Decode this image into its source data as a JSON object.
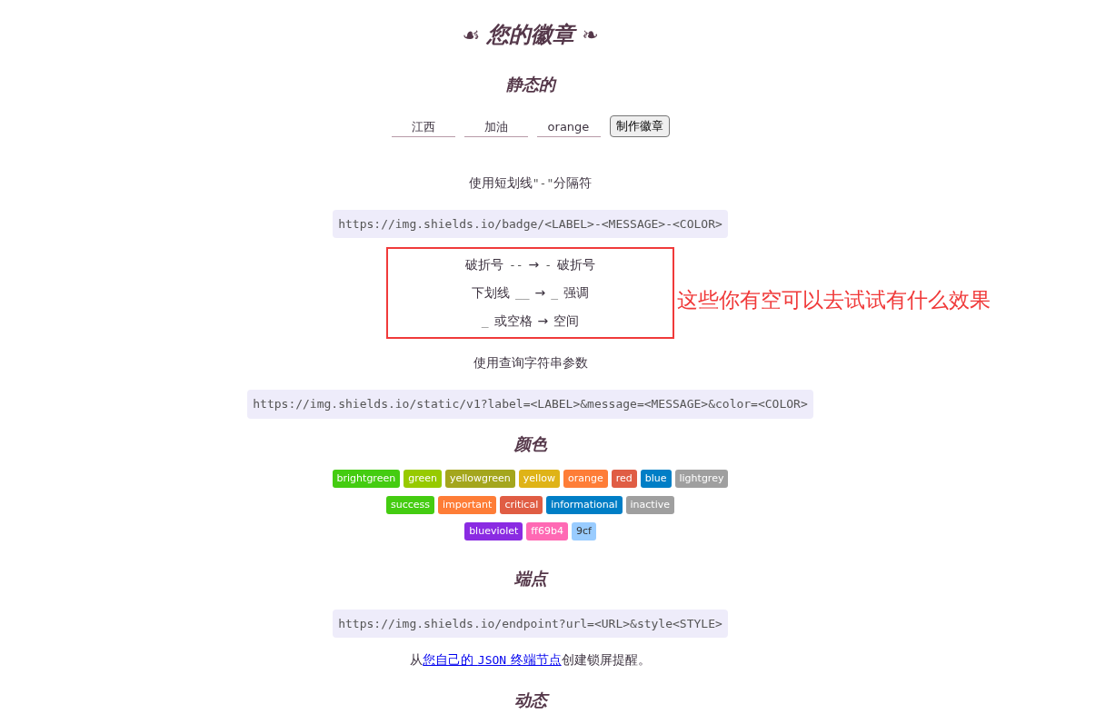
{
  "title": {
    "left_ornament": "☙",
    "text": "您的徽章",
    "right_ornament": "❧"
  },
  "static": {
    "heading": "静态的",
    "inputs": [
      {
        "value": "江西"
      },
      {
        "value": "加油"
      },
      {
        "value": "orange"
      }
    ],
    "button": "制作徽章",
    "dash_note": {
      "before": "使用短划线",
      "code": "\"-\"",
      "after": "分隔符"
    },
    "badge_url": "https://img.shields.io/badge/<LABEL>-<MESSAGE>-<COLOR>",
    "escapes": [
      {
        "segments": [
          {
            "kind": "text",
            "text": "破折号"
          },
          {
            "kind": "code",
            "text": "--"
          },
          {
            "kind": "text",
            "text": "→"
          },
          {
            "kind": "code",
            "text": "-"
          },
          {
            "kind": "text",
            "text": "破折号"
          }
        ]
      },
      {
        "segments": [
          {
            "kind": "text",
            "text": "下划线"
          },
          {
            "kind": "code",
            "text": "__"
          },
          {
            "kind": "text",
            "text": "→"
          },
          {
            "kind": "code",
            "text": "_"
          },
          {
            "kind": "text",
            "text": "强调"
          }
        ]
      },
      {
        "segments": [
          {
            "kind": "code",
            "text": "_"
          },
          {
            "kind": "text",
            "text": "或空格"
          },
          {
            "kind": "text",
            "text": "→"
          },
          {
            "kind": "text",
            "text": "空间"
          }
        ]
      }
    ],
    "annotation": "这些你有空可以去试试有什么效果",
    "query_note": "使用查询字符串参数",
    "query_url": "https://img.shields.io/static/v1?label=<LABEL>&message=<MESSAGE>&color=<COLOR>"
  },
  "colors": {
    "heading": "颜色",
    "rows": [
      {
        "badges": [
          {
            "label": "brightgreen",
            "color": "#44cc11",
            "dark_text": false
          },
          {
            "label": "green",
            "color": "#97ca00",
            "dark_text": false
          },
          {
            "label": "yellowgreen",
            "color": "#a4a61d",
            "dark_text": false
          },
          {
            "label": "yellow",
            "color": "#dfb317",
            "dark_text": false
          },
          {
            "label": "orange",
            "color": "#fe7d37",
            "dark_text": false
          },
          {
            "label": "red",
            "color": "#e05d44",
            "dark_text": false
          },
          {
            "label": "blue",
            "color": "#007ec6",
            "dark_text": false
          },
          {
            "label": "lightgrey",
            "color": "#9f9f9f",
            "dark_text": false
          }
        ]
      },
      {
        "badges": [
          {
            "label": "success",
            "color": "#44cc11",
            "dark_text": false
          },
          {
            "label": "important",
            "color": "#fe7d37",
            "dark_text": false
          },
          {
            "label": "critical",
            "color": "#e05d44",
            "dark_text": false
          },
          {
            "label": "informational",
            "color": "#007ec6",
            "dark_text": false
          },
          {
            "label": "inactive",
            "color": "#9f9f9f",
            "dark_text": false
          }
        ]
      },
      {
        "badges": [
          {
            "label": "blueviolet",
            "color": "#8a2be2",
            "dark_text": false
          },
          {
            "label": "ff69b4",
            "color": "#ff69b4",
            "dark_text": false
          },
          {
            "label": "9cf",
            "color": "#99ccff",
            "dark_text": true
          }
        ]
      }
    ]
  },
  "endpoint": {
    "heading": "端点",
    "url": "https://img.shields.io/endpoint?url=<URL>&style<STYLE>",
    "note": {
      "before": "从",
      "link": {
        "before": "您自己的 ",
        "code": "JSON",
        "after": " 终端节点"
      },
      "after": "创建锁屏提醒。"
    }
  },
  "dynamic": {
    "heading": "动态"
  }
}
